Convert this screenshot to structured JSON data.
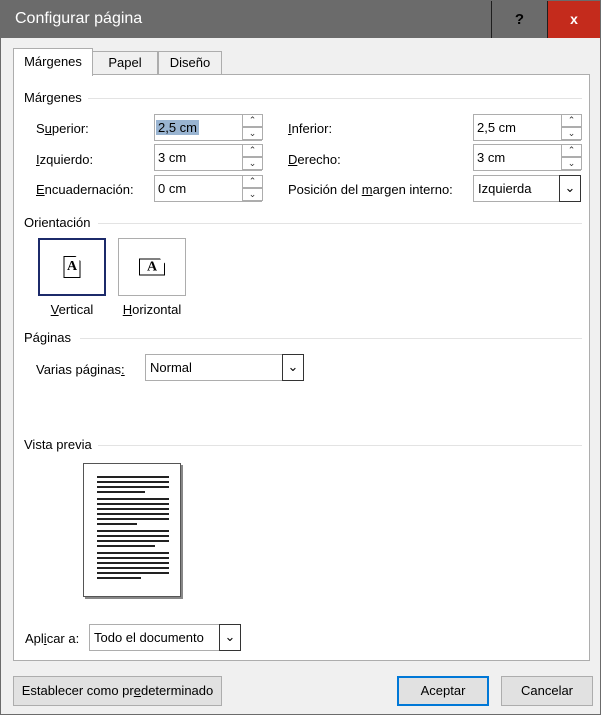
{
  "window": {
    "title": "Configurar página",
    "help_label": "?",
    "close_label": "x"
  },
  "tabs": [
    {
      "label": "Márgenes",
      "active": true
    },
    {
      "label": "Papel",
      "active": false
    },
    {
      "label": "Diseño",
      "active": false
    }
  ],
  "margins": {
    "section_label": "Márgenes",
    "superior": {
      "label_pre": "S",
      "label_u": "u",
      "label_post": "perior:",
      "value": "2,5 cm"
    },
    "izquierdo": {
      "label_pre": "",
      "label_u": "I",
      "label_post": "zquierdo:",
      "value": "3 cm"
    },
    "encuadernacion": {
      "label_pre": "",
      "label_u": "E",
      "label_post": "ncuadernación:",
      "value": "0 cm"
    },
    "inferior": {
      "label_pre": "",
      "label_u": "I",
      "label_post": "nferior:",
      "value": "2,5 cm"
    },
    "derecho": {
      "label_pre": "",
      "label_u": "D",
      "label_post": "erecho:",
      "value": "3 cm"
    },
    "posicion": {
      "label_pre": "Posición del ",
      "label_u": "m",
      "label_post": "argen interno:",
      "value": "Izquierda"
    }
  },
  "orientation": {
    "section_label": "Orientación",
    "portrait": {
      "label_u": "V",
      "label_post": "ertical",
      "glyph": "A",
      "selected": true
    },
    "landscape": {
      "label_u": "H",
      "label_post": "orizontal",
      "glyph": "A",
      "selected": false
    }
  },
  "pages": {
    "section_label": "Páginas",
    "multiple": {
      "label_pre": "Varias páginas",
      "label_u": ":",
      "label_post": "",
      "value": "Normal"
    }
  },
  "preview": {
    "section_label": "Vista previa",
    "apply": {
      "label_pre": "Apl",
      "label_u": "i",
      "label_post": "car a:",
      "value": "Todo el documento"
    }
  },
  "footer": {
    "default_pre": "Establecer como pr",
    "default_u": "e",
    "default_post": "determinado",
    "ok_label": "Aceptar",
    "cancel_label": "Cancelar"
  },
  "colors": {
    "titlebar": "#6b6b6b",
    "close": "#c42b1c",
    "default_button_border": "#0078d7",
    "selection": "#99b4d1"
  }
}
